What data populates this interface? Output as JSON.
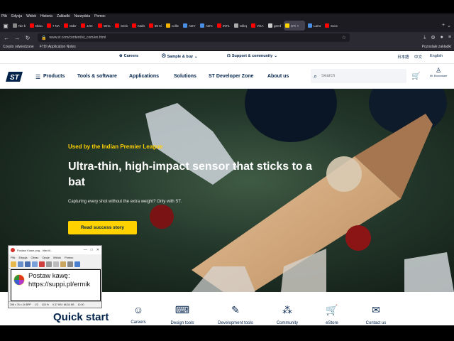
{
  "browser": {
    "menu": [
      "Plik",
      "Edycja",
      "Widok",
      "Historia",
      "Zakładki",
      "Narzędzia",
      "Pomoc"
    ],
    "tabs": [
      {
        "label": "Nie b",
        "color": "#888888"
      },
      {
        "label": "Dlacz",
        "color": "#ff0000"
      },
      {
        "label": "7 NA",
        "color": "#ff0000"
      },
      {
        "label": "Odzn",
        "color": "#ff0000"
      },
      {
        "label": "JAN I",
        "color": "#ff0000"
      },
      {
        "label": "Wreu",
        "color": "#ff0000"
      },
      {
        "label": "Senic",
        "color": "#ff0000"
      },
      {
        "label": "Kalen",
        "color": "#ff0000"
      },
      {
        "label": "80 Ki",
        "color": "#ff0000"
      },
      {
        "label": "collec",
        "color": "#f5b400"
      },
      {
        "label": "ADV7",
        "color": "#4a90e2"
      },
      {
        "label": "ADV4",
        "color": "#4a90e2"
      },
      {
        "label": "INT1",
        "color": "#ff0000"
      },
      {
        "label": "Sklep",
        "color": "#aaaaaa"
      },
      {
        "label": "VGA",
        "color": "#ff0000"
      },
      {
        "label": "gemb",
        "color": "#cccccc"
      },
      {
        "label": "STi",
        "color": "#ffd200",
        "active": true
      },
      {
        "label": "Lame",
        "color": "#4a90e2"
      },
      {
        "label": "Socce",
        "color": "#ff0000"
      }
    ],
    "url": "www.st.com/content/st_com/en.html",
    "bookmarks": [
      "Często odwiedzane",
      "FTDI Application Notes"
    ],
    "bookmarks_right": "Pozostałe zakładki"
  },
  "site": {
    "top_links": {
      "careers": "Careers",
      "sample_buy": "Sample & buy",
      "support": "Support & community"
    },
    "languages": [
      "日本語",
      "中文",
      "English"
    ],
    "nav": {
      "products": "Products",
      "tools": "Tools & software",
      "applications": "Applications",
      "solutions": "Solutions",
      "dev_zone": "ST Developer Zone",
      "about": "About us"
    },
    "search_placeholder": "Search",
    "user_name": "Mr. Ekonomizer",
    "hero": {
      "eyebrow": "Used by the Indian Premier League",
      "headline": "Ultra-thin, high-impact sensor that sticks to a bat",
      "sub": "Capturing every shot without the extra weight? Only with ST.",
      "cta": "Read success story"
    },
    "quick_start": {
      "title": "Quick start",
      "items": [
        "Careers",
        "Design tools",
        "Development tools",
        "Community",
        "eStore",
        "Contact us"
      ]
    }
  },
  "irfanview": {
    "title": "Postaw Kawe.png - IrfanVi...",
    "menu": [
      "Plik",
      "Edycja",
      "Obraz",
      "Opcje",
      "Widok",
      "Pomoc"
    ],
    "text_line1": "Postaw kawę:",
    "text_line2": "https://suppi.pl/ermik",
    "status": [
      "298 x 76 x 24 BPP",
      "1/3",
      "100 %",
      "9.37 KB / 66.54 KB",
      "10.00"
    ]
  },
  "colors": {
    "st_navy": "#03234b",
    "st_yellow": "#ffd200",
    "st_blue": "#3cb4e6"
  }
}
